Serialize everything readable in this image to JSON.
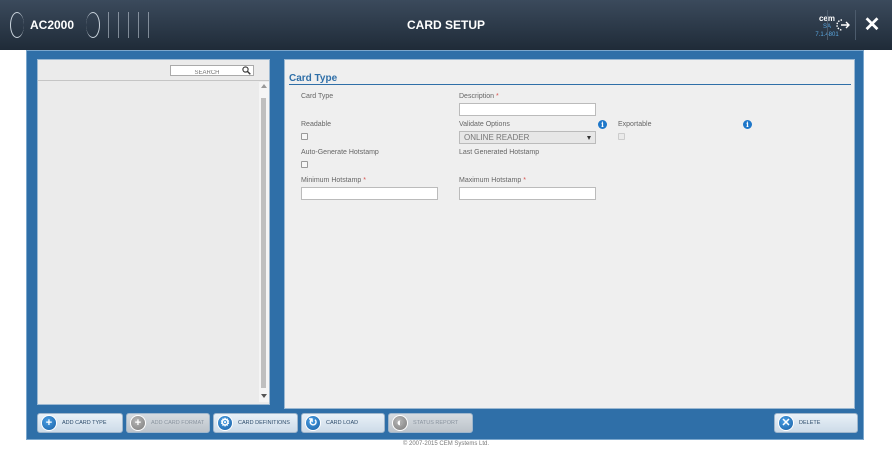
{
  "header": {
    "app_name": "AC2000",
    "title": "CARD SETUP",
    "brand": "cem",
    "version": "SA 7.1.4801"
  },
  "sidebar": {
    "search_placeholder": "SEARCH"
  },
  "form": {
    "section_title": "Card Type",
    "card_type_label": "Card Type",
    "description_label": "Description",
    "description_value": "",
    "readable_label": "Readable",
    "validate_options_label": "Validate Options",
    "validate_options_value": "ONLINE READER",
    "exportable_label": "Exportable",
    "auto_generate_label": "Auto-Generate Hotstamp",
    "last_generated_label": "Last Generated Hotstamp",
    "minimum_hotstamp_label": "Minimum Hotstamp",
    "minimum_hotstamp_value": "",
    "maximum_hotstamp_label": "Maximum Hotstamp",
    "maximum_hotstamp_value": "",
    "required_marker": "*"
  },
  "toolbar": {
    "add_card_type": "ADD CARD TYPE",
    "add_card_format": "ADD CARD FORMAT",
    "card_definitions": "CARD DEFINITIONS",
    "card_load": "CARD LOAD",
    "status_report": "STATUS REPORT",
    "delete": "DELETE"
  },
  "footer": {
    "copyright": "© 2007-2015 CEM Systems Ltd."
  },
  "colors": {
    "accent": "#2f6fa8",
    "header": "#1f2b38",
    "info": "#1e77c9",
    "required": "#d9534f"
  },
  "icons": {
    "search": "magnifier-icon",
    "logout": "logout-icon",
    "close": "close-icon",
    "info": "info-icon"
  }
}
